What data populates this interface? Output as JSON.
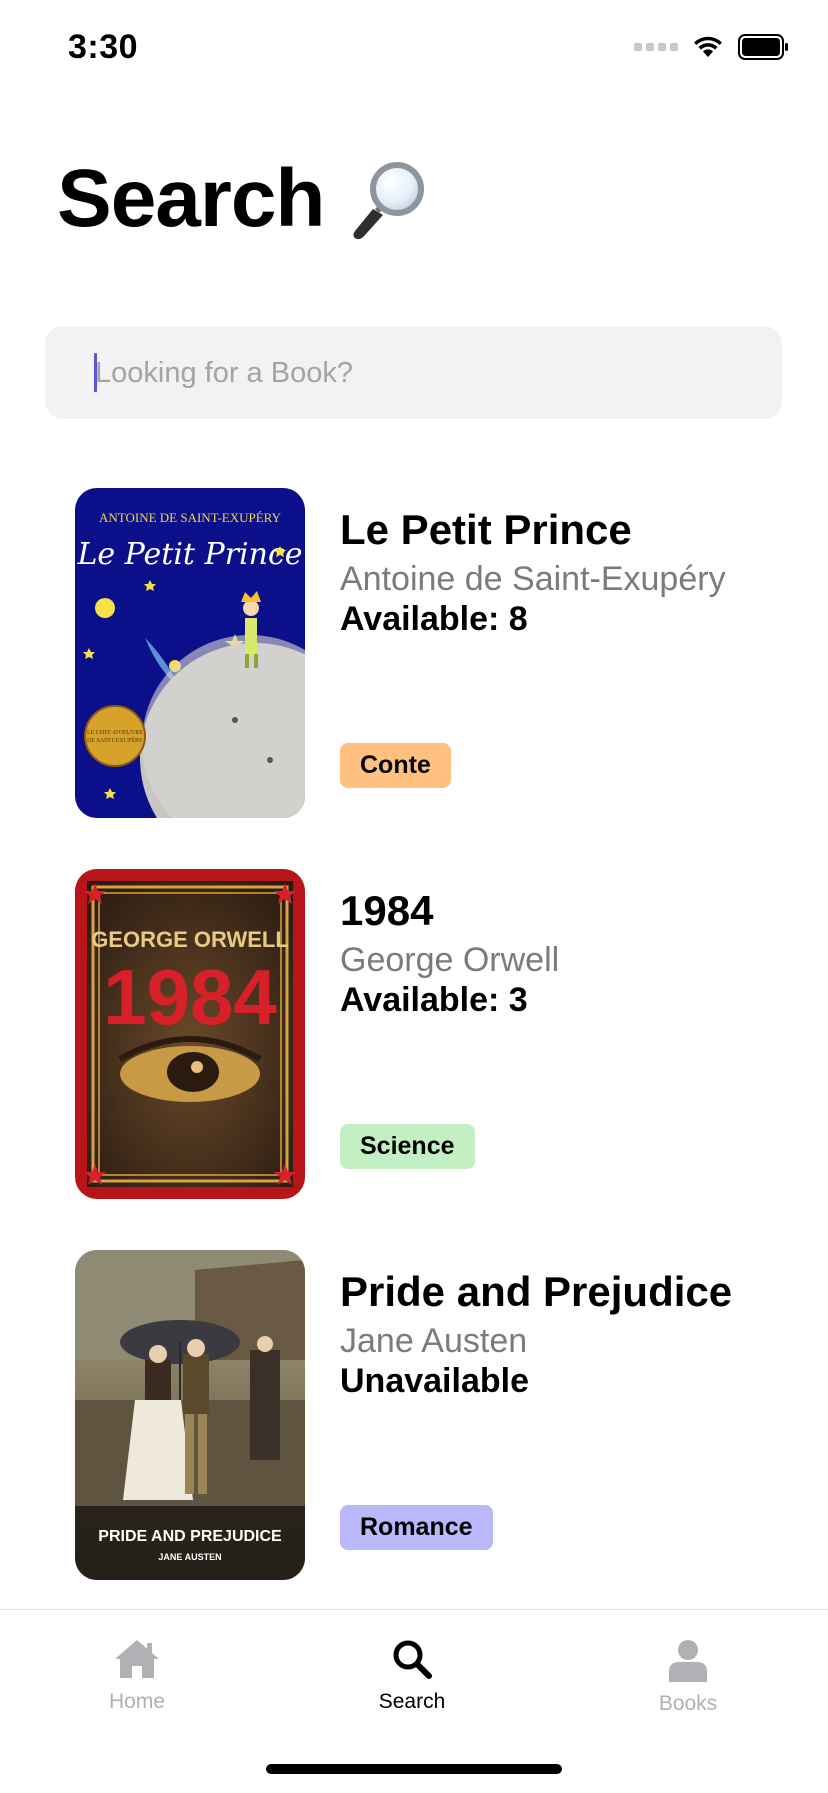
{
  "status_bar": {
    "time": "3:30"
  },
  "header": {
    "title": "Search",
    "title_icon": "magnifying-glass-emoji"
  },
  "search": {
    "placeholder": "Looking for a Book?",
    "value": ""
  },
  "books": [
    {
      "title": "Le Petit Prince",
      "author": "Antoine de Saint-Exupéry",
      "availability": "Available: 8",
      "genre": "Conte",
      "genre_color": "#ffc080",
      "cover_texts": [
        "ANTOINE DE SAINT-EXUPÉRY",
        "Le Petit Prince"
      ]
    },
    {
      "title": "1984",
      "author": "George Orwell",
      "availability": "Available: 3",
      "genre": "Science",
      "genre_color": "#c2f0c2",
      "cover_texts": [
        "GEORGE ORWELL",
        "1984"
      ]
    },
    {
      "title": "Pride and Prejudice",
      "author": "Jane Austen",
      "availability": "Unavailable",
      "genre": "Romance",
      "genre_color": "#b8b8fb",
      "cover_texts": [
        "PRIDE AND PREJUDICE",
        "JANE AUSTEN"
      ]
    }
  ],
  "tab_bar": {
    "items": [
      {
        "label": "Home",
        "icon": "house-icon",
        "active": false
      },
      {
        "label": "Search",
        "icon": "search-icon",
        "active": true
      },
      {
        "label": "Books",
        "icon": "person-icon",
        "active": false
      }
    ],
    "active_color": "#000000",
    "inactive_color": "#b0b0b5"
  }
}
